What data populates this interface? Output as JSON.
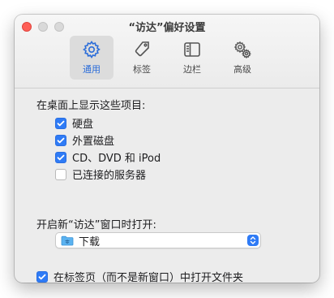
{
  "window": {
    "title": "“访达”偏好设置"
  },
  "toolbar": {
    "tabs": [
      {
        "label": "通用",
        "icon": "gear-icon",
        "active": true
      },
      {
        "label": "标签",
        "icon": "tag-icon",
        "active": false
      },
      {
        "label": "边栏",
        "icon": "sidebar-icon",
        "active": false
      },
      {
        "label": "高级",
        "icon": "gears-icon",
        "active": false
      }
    ]
  },
  "desktop_section": {
    "title": "在桌面上显示这些项目:",
    "items": [
      {
        "label": "硬盘",
        "checked": true
      },
      {
        "label": "外置磁盘",
        "checked": true
      },
      {
        "label": "CD、DVD 和 iPod",
        "checked": true
      },
      {
        "label": "已连接的服务器",
        "checked": false
      }
    ]
  },
  "new_window": {
    "title": "开启新“访达”窗口时打开:",
    "selected": "下载",
    "selected_icon": "folder-icon"
  },
  "tabs_option": {
    "label": "在标签页（而不是新窗口）中打开文件夹",
    "checked": true
  },
  "colors": {
    "accent": "#2f7bf6",
    "close": "#ff5f57",
    "window_bg": "#ececec"
  }
}
